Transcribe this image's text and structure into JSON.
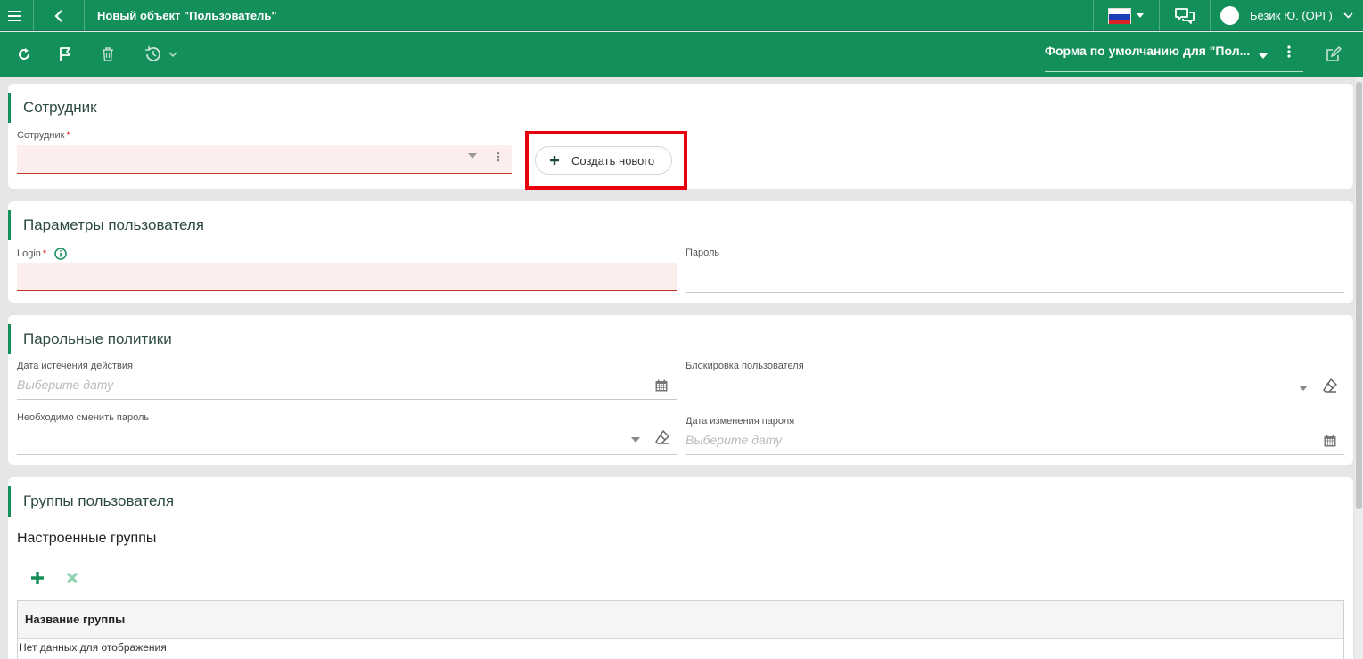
{
  "topbar": {
    "title": "Новый объект \"Пользователь\"",
    "user": "Безик Ю. (ОРГ)",
    "icons": [
      "menu-icon",
      "back-icon",
      "flag-ru-icon",
      "chat-icon",
      "avatar",
      "chevron-down-icon"
    ]
  },
  "toolbar": {
    "form_name": "Форма по умолчанию для \"Пол...",
    "icons": [
      "refresh-icon",
      "flag-icon",
      "trash-icon",
      "history-icon",
      "more-vertical-icon",
      "edit-icon"
    ]
  },
  "employee_section": {
    "title": "Сотрудник",
    "field_label": "Сотрудник",
    "required_mark": "*",
    "create_button": "Создать нового"
  },
  "user_params": {
    "title": "Параметры пользователя",
    "login_label": "Login",
    "password_label": "Пароль"
  },
  "password_policies": {
    "title": "Парольные политики",
    "expiry_label": "Дата истечения действия",
    "expiry_placeholder": "Выберите дату",
    "block_label": "Блокировка пользователя",
    "must_change_label": "Необходимо сменить пароль",
    "change_date_label": "Дата изменения пароля",
    "change_date_placeholder": "Выберите дату"
  },
  "user_groups": {
    "title": "Группы пользователя",
    "subtitle": "Настроенные группы",
    "column_header": "Название группы",
    "empty_text": "Нет данных для отображения"
  },
  "colors": {
    "brand": "#138f5a",
    "error_bg": "#fdeeee",
    "highlight": "#e8000d"
  }
}
